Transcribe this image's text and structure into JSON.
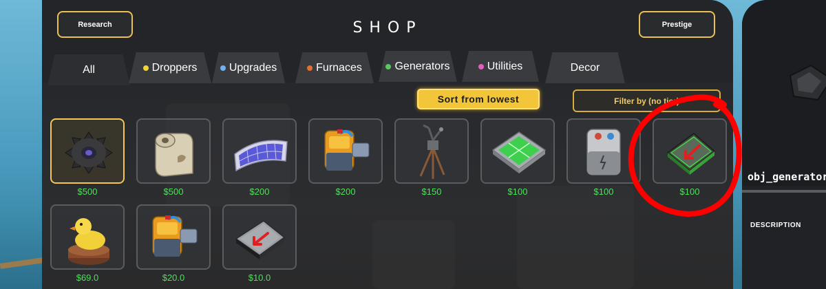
{
  "header": {
    "research_label": "Research",
    "title": "SHOP",
    "prestige_label": "Prestige"
  },
  "tabs": [
    {
      "label": "All",
      "dot_color": null,
      "active": true
    },
    {
      "label": "Droppers",
      "dot_color": "#f2d43a"
    },
    {
      "label": "Upgrades",
      "dot_color": "#6fb2ef"
    },
    {
      "label": "Furnaces",
      "dot_color": "#e2702e"
    },
    {
      "label": "Generators",
      "dot_color": "#58c95a"
    },
    {
      "label": "Utilities",
      "dot_color": "#e25fc0"
    },
    {
      "label": "Decor",
      "dot_color": null
    }
  ],
  "controls": {
    "sort_label": "Sort from lowest",
    "filter_label": "Filter by (no tier)"
  },
  "items": [
    {
      "price": "$500",
      "icon": "spiked-tire-icon",
      "selected": true
    },
    {
      "price": "$500",
      "icon": "paper-roll-icon"
    },
    {
      "price": "$200",
      "icon": "solar-panel-icon"
    },
    {
      "price": "$200",
      "icon": "orange-machine-icon"
    },
    {
      "price": "$150",
      "icon": "wooden-tripod-icon"
    },
    {
      "price": "$100",
      "icon": "green-tile-pad-icon"
    },
    {
      "price": "$100",
      "icon": "battery-icon"
    },
    {
      "price": "$100",
      "icon": "green-arrow-generator-icon",
      "annotated": true
    },
    {
      "price": "$69.0",
      "icon": "rubber-duck-trophy-icon"
    },
    {
      "price": "$20.0",
      "icon": "orange-machine-icon"
    },
    {
      "price": "$10.0",
      "icon": "gray-arrow-generator-icon"
    }
  ],
  "detail": {
    "name": "obj_generator_",
    "description_heading": "DESCRIPTION"
  },
  "colors": {
    "accent": "#f2c85a",
    "price": "#4fe05b",
    "annotation": "#ff0000",
    "panel": "#1d1f23"
  }
}
